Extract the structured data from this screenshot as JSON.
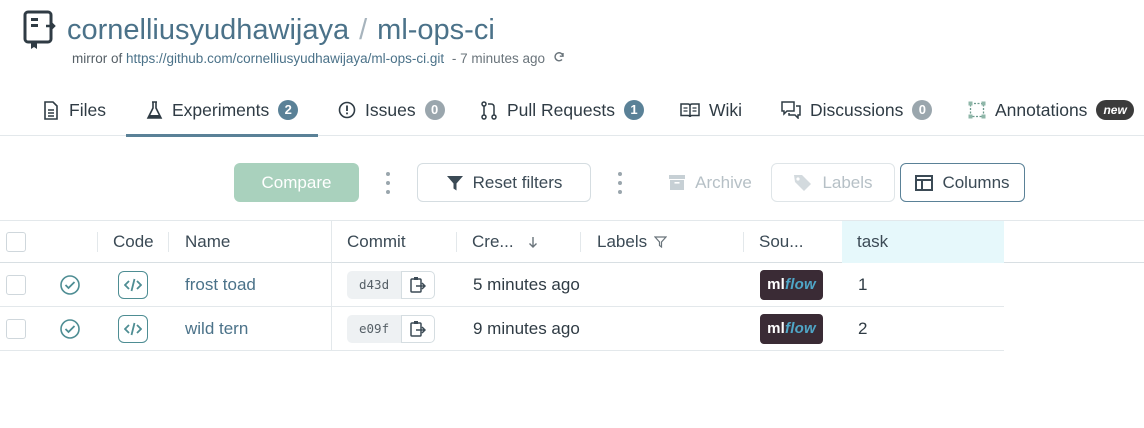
{
  "repo": {
    "owner": "cornelliusyudhawijaya",
    "separator": "/",
    "name": "ml-ops-ci",
    "mirror_prefix": "mirror of",
    "mirror_url": "https://github.com/cornelliusyudhawijaya/ml-ops-ci.git",
    "mirror_ago": "- 7 minutes ago"
  },
  "tabs": [
    {
      "label": "Files",
      "icon": "file-icon"
    },
    {
      "label": "Experiments",
      "icon": "flask-icon",
      "badge": "2",
      "active": true
    },
    {
      "label": "Issues",
      "icon": "issue-icon",
      "badge": "0"
    },
    {
      "label": "Pull Requests",
      "icon": "pull-request-icon",
      "badge": "1"
    },
    {
      "label": "Wiki",
      "icon": "book-icon"
    },
    {
      "label": "Discussions",
      "icon": "chat-icon",
      "badge": "0"
    },
    {
      "label": "Annotations",
      "icon": "annotation-icon",
      "badge": "new"
    }
  ],
  "toolbar": {
    "compare": "Compare",
    "reset_filters": "Reset filters",
    "archive": "Archive",
    "labels": "Labels",
    "columns": "Columns"
  },
  "table": {
    "headers": {
      "code": "Code",
      "name": "Name",
      "commit": "Commit",
      "created": "Cre...",
      "labels": "Labels",
      "source": "Sou...",
      "task": "task"
    },
    "rows": [
      {
        "name": "frost toad",
        "commit": "d43d",
        "created": "5 minutes ago",
        "source": "mlflow",
        "task": "1"
      },
      {
        "name": "wild tern",
        "commit": "e09f",
        "created": "9 minutes ago",
        "source": "mlflow",
        "task": "2"
      }
    ]
  },
  "colors": {
    "accent": "#5a8197",
    "link": "#4b7289",
    "compare_bg": "#a9d1bd",
    "task_header_bg": "#e6f8fb",
    "mlflow_bg": "#3a2b35"
  }
}
